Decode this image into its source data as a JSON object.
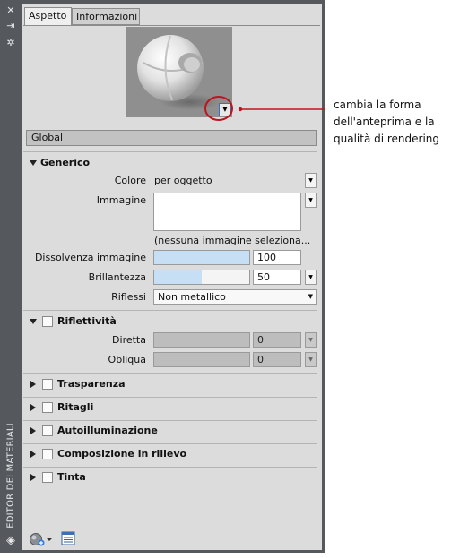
{
  "side": {
    "title": "EDITOR DEI MATERIALI",
    "icons": [
      "close-icon",
      "pin-icon",
      "properties-icon",
      "materials-logo-icon"
    ]
  },
  "tabs": [
    {
      "label": "Aspetto",
      "active": true
    },
    {
      "label": "Informazioni",
      "active": false
    }
  ],
  "preview": {
    "dropdown_glyph": "▼"
  },
  "material_name": "Global",
  "sections": {
    "generico": {
      "title": "Generico",
      "colore_label": "Colore",
      "colore_value": "per oggetto",
      "immagine_label": "Immagine",
      "immagine_caption": "(nessuna immagine seleziona...",
      "dissolvenza_label": "Dissolvenza immagine",
      "dissolvenza_value": "100",
      "dissolvenza_fraction": 1.0,
      "brillantezza_label": "Brillantezza",
      "brillantezza_value": "50",
      "brillantezza_fraction": 0.5,
      "riflessi_label": "Riflessi",
      "riflessi_value": "Non metallico"
    },
    "riflettivita": {
      "title": "Riflettività",
      "diretta_label": "Diretta",
      "diretta_value": "0",
      "obliqua_label": "Obliqua",
      "obliqua_value": "0"
    },
    "collapsed": [
      {
        "title": "Trasparenza"
      },
      {
        "title": "Ritagli"
      },
      {
        "title": "Autoilluminazione"
      },
      {
        "title": "Composizione in rilievo"
      },
      {
        "title": "Tinta"
      }
    ]
  },
  "toolbar": {
    "icons": [
      "create-material-icon",
      "material-browser-icon"
    ]
  },
  "annotation": {
    "line1": "cambia la forma",
    "line2": "dell'anteprima e la",
    "line3": "qualità di rendering",
    "color": "#c0141c"
  }
}
